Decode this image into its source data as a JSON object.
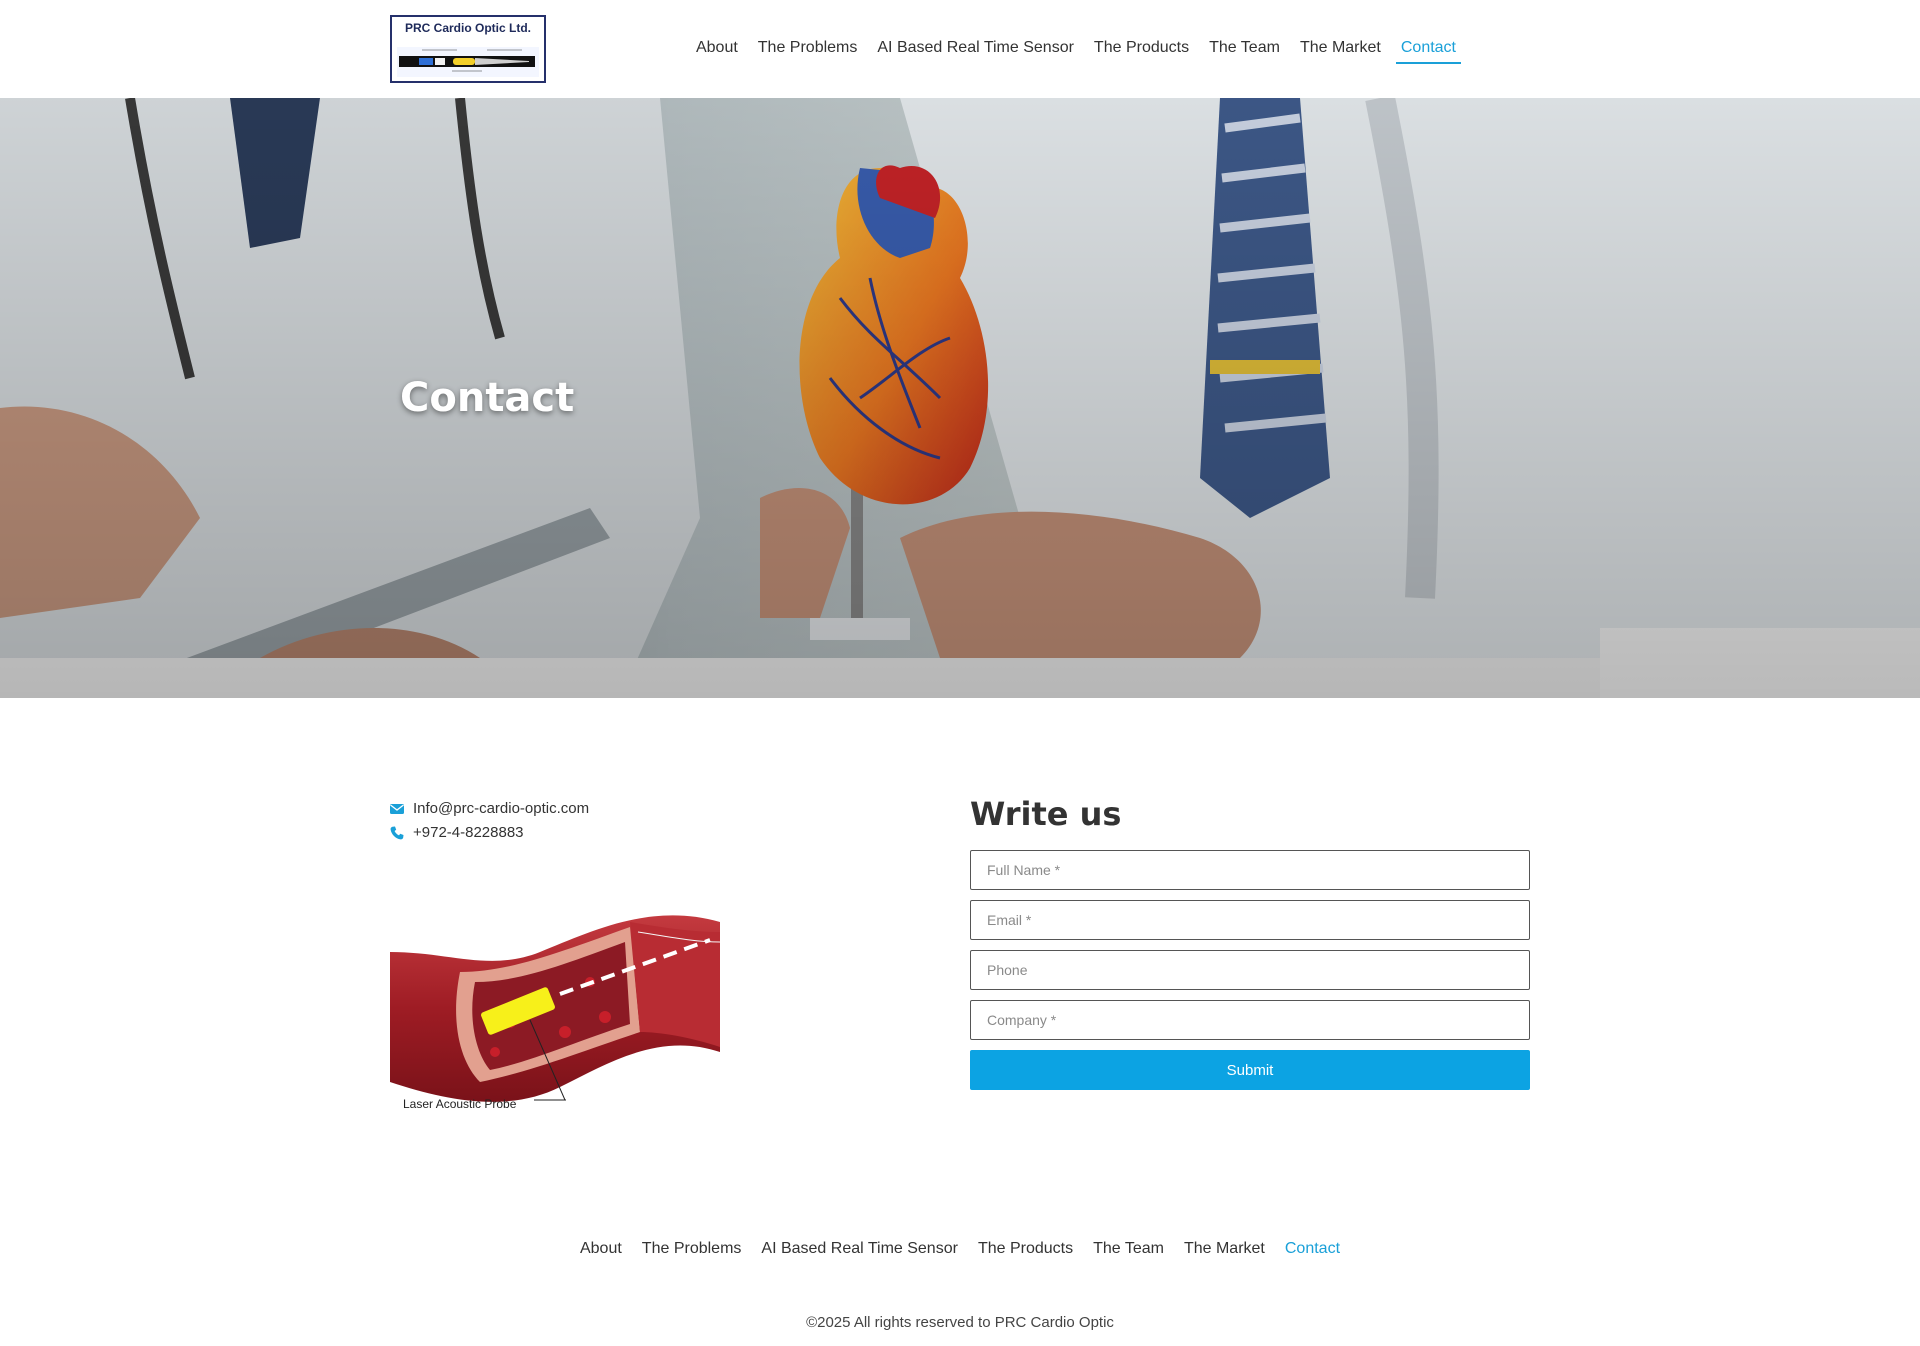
{
  "brand": {
    "logo_text": "PRC Cardio Optic Ltd."
  },
  "nav": {
    "items": [
      {
        "label": "About"
      },
      {
        "label": "The Problems"
      },
      {
        "label": "AI Based Real Time Sensor"
      },
      {
        "label": "The Products"
      },
      {
        "label": "The Team"
      },
      {
        "label": "The Market"
      },
      {
        "label": "Contact",
        "active": true
      }
    ]
  },
  "hero": {
    "title": "Contact"
  },
  "contact": {
    "email": "Info@prc-cardio-optic.com",
    "phone": "+972-4-8228883",
    "image_caption": "Laser Acoustic Probe"
  },
  "form": {
    "title": "Write us",
    "full_name_placeholder": "Full Name *",
    "email_placeholder": "Email *",
    "phone_placeholder": "Phone",
    "company_placeholder": "Company *",
    "submit_label": "Submit"
  },
  "footer": {
    "copyright": "©2025 All rights reserved to PRC Cardio Optic"
  },
  "colors": {
    "accent": "#0ca3e3",
    "active_link": "#1aa0d8",
    "text": "#333333"
  },
  "icons": {
    "email": "envelope-icon",
    "phone": "phone-icon"
  }
}
